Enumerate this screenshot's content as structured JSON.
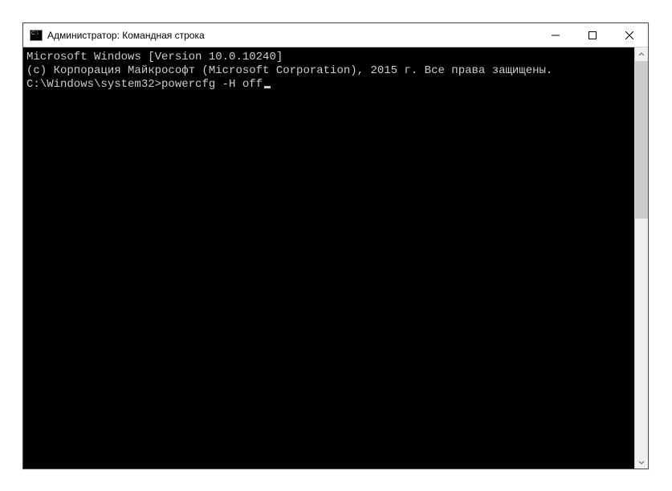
{
  "window": {
    "title": "Администратор: Командная строка"
  },
  "console": {
    "line1": "Microsoft Windows [Version 10.0.10240]",
    "line2": "(c) Корпорация Майкрософт (Microsoft Corporation), 2015 г. Все права защищены.",
    "blank": "",
    "prompt": "C:\\Windows\\system32>",
    "command": "powercfg -H off"
  }
}
